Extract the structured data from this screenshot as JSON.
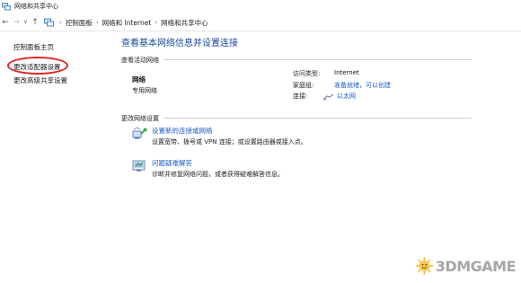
{
  "window": {
    "title": "网络和共享中心"
  },
  "address_bar": {
    "breadcrumbs": [
      "控制面板",
      "网络和 Internet",
      "网络和共享中心"
    ]
  },
  "left_nav": {
    "items": [
      "控制面板主页",
      "更改适配器设置",
      "更改高级共享设置"
    ]
  },
  "main": {
    "title": "查看基本网络信息并设置连接",
    "active_networks": {
      "section_label": "查看活动网络",
      "network_name": "网络",
      "network_type": "专用网络",
      "access_type_label": "访问类型:",
      "access_type_value": "Internet",
      "homegroup_label": "家庭组:",
      "homegroup_value": "准备就绪，可以创建",
      "connections_label": "连接:",
      "connections_value": "以太网"
    },
    "change_settings": {
      "section_label": "更改网络设置",
      "tasks": [
        {
          "link": "设置新的连接或网络",
          "description": "设置宽带、拨号或 VPN 连接；或设置路由器或接入点。",
          "icon": "network-setup-icon"
        },
        {
          "link": "问题疑难解答",
          "description": "诊断并修复网络问题，或者获得疑难解答信息。",
          "icon": "troubleshoot-icon"
        }
      ]
    }
  },
  "watermark": {
    "text": "3DMGAME"
  },
  "colors": {
    "link": "#1e5cc8",
    "title": "#1b4aa0",
    "highlight_oval": "#e0262a"
  }
}
